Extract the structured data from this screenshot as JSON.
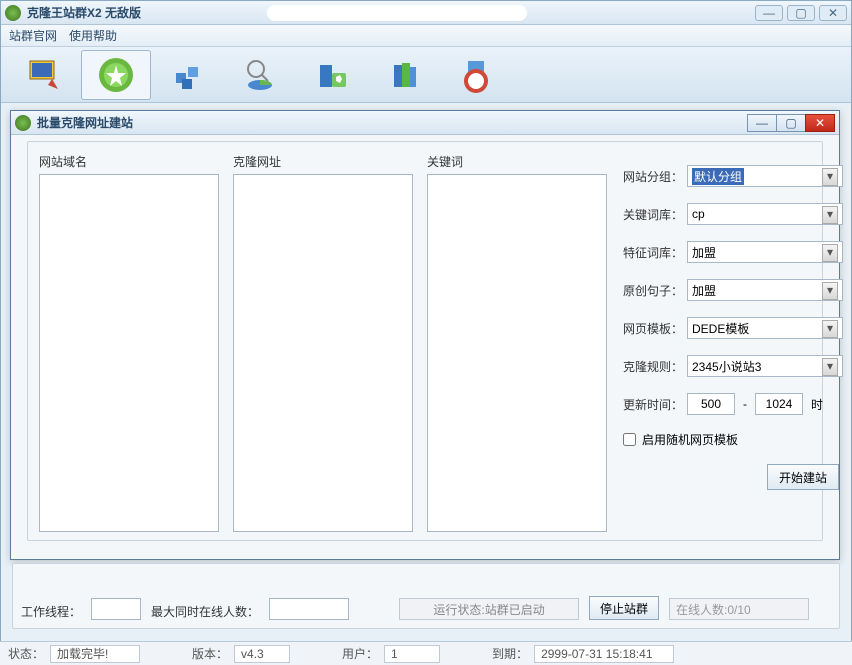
{
  "mainWindow": {
    "title": "克隆王站群X2 无敌版"
  },
  "menu": {
    "item1": "站群官网",
    "item2": "使用帮助"
  },
  "childWindow": {
    "title": "批量克隆网址建站"
  },
  "columns": {
    "domain_label": "网站域名",
    "clone_label": "克隆网址",
    "keyword_label": "关键词"
  },
  "settings": {
    "group_label": "网站分组：",
    "group_value": "默认分组",
    "keywordlib_label": "关键词库：",
    "keywordlib_value": "cp",
    "featurelib_label": "特征词库：",
    "featurelib_value": "加盟",
    "sentence_label": "原创句子：",
    "sentence_value": "加盟",
    "template_label": "网页模板：",
    "template_value": "DEDE模板",
    "rule_label": "克隆规则：",
    "rule_value": "2345小说站3",
    "updatetime_label": "更新时间：",
    "updatetime_from": "500",
    "updatetime_sep": "-",
    "updatetime_to": "1024",
    "updatetime_unit": "时",
    "random_template_label": "启用随机网页模板",
    "start_button": "开始建站"
  },
  "bottom": {
    "thread_label": "工作线程：",
    "thread_value": "",
    "maxonline_label": "最大同时在线人数：",
    "maxonline_value": "",
    "runstatus": "运行状态:站群已启动",
    "stop_button": "停止站群",
    "online_text": "在线人数:0/10"
  },
  "statusbar": {
    "status_label": "状态：",
    "status_value": "加载完毕!",
    "version_label": "版本：",
    "version_value": "v4.3",
    "user_label": "用户：",
    "user_value": "1",
    "expire_label": "到期：",
    "expire_value": "2999-07-31 15:18:41"
  }
}
